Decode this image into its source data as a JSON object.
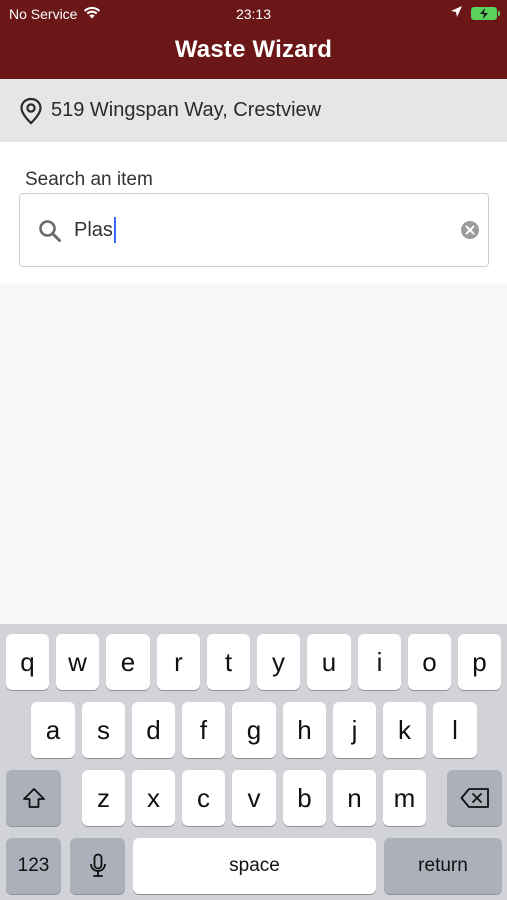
{
  "status_bar": {
    "carrier": "No Service",
    "time": "23:13"
  },
  "header": {
    "title": "Waste Wizard"
  },
  "address": {
    "text": "519 Wingspan Way, Crestview"
  },
  "search": {
    "label": "Search an item",
    "value": "Plas"
  },
  "keyboard": {
    "row1": [
      "q",
      "w",
      "e",
      "r",
      "t",
      "y",
      "u",
      "i",
      "o",
      "p"
    ],
    "row2": [
      "a",
      "s",
      "d",
      "f",
      "g",
      "h",
      "j",
      "k",
      "l"
    ],
    "row3": [
      "z",
      "x",
      "c",
      "v",
      "b",
      "n",
      "m"
    ],
    "numbers_label": "123",
    "space_label": "space",
    "return_label": "return"
  },
  "colors": {
    "header_bg": "#6b1717",
    "address_bg": "#e6e6e6",
    "keyboard_bg": "#d1d3d9",
    "caret": "#3a6bff"
  }
}
